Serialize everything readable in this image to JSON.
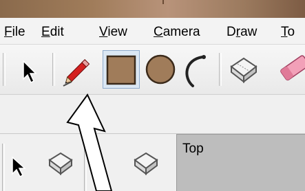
{
  "menu": {
    "items": [
      {
        "hot": "F",
        "rest": "ile"
      },
      {
        "hot": "E",
        "rest": "dit"
      },
      {
        "hot": "V",
        "rest": "iew"
      },
      {
        "hot": "C",
        "rest": "amera"
      },
      {
        "pre": "D",
        "hot": "r",
        "rest": "aw"
      },
      {
        "hot": "T",
        "rest": "o"
      }
    ]
  },
  "toolbar": {
    "tools": [
      "select-tool",
      "pencil-tool",
      "rectangle-tool",
      "circle-tool",
      "arc-tool",
      "component-tool",
      "eraser-tool"
    ],
    "selected": "rectangle-tool"
  },
  "viewport": {
    "label": "Top"
  },
  "colors": {
    "shape_fill": "#a07c5a",
    "shape_stroke": "#3b2a1a",
    "pencil_red": "#d42020"
  }
}
